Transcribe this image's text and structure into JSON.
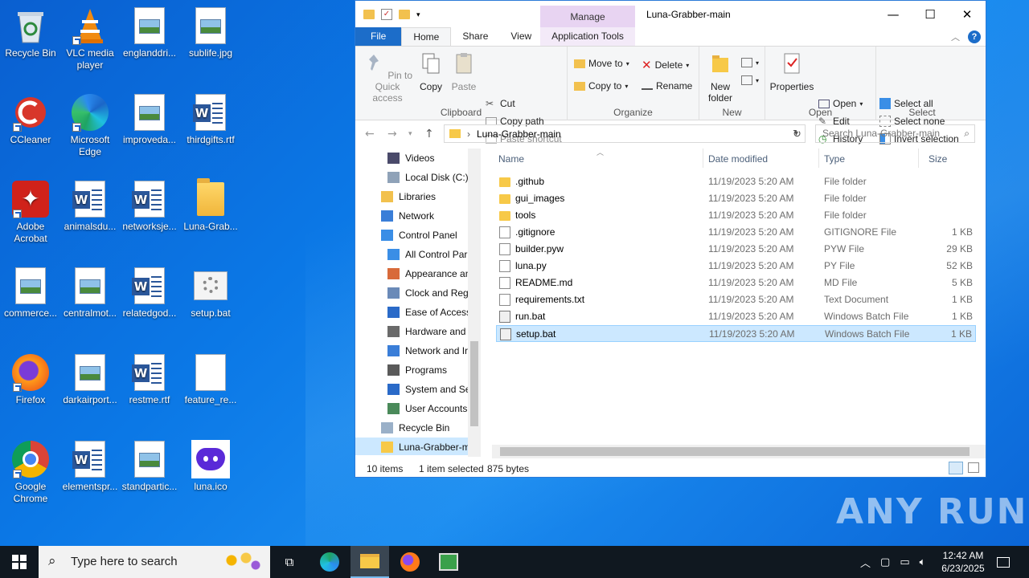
{
  "desktop": {
    "icons": [
      {
        "label": "Recycle Bin",
        "icon": "recycle-bin-icon"
      },
      {
        "label": "VLC media player",
        "icon": "vlc-icon"
      },
      {
        "label": "englanddri...",
        "icon": "image-file-icon"
      },
      {
        "label": "sublife.jpg",
        "icon": "image-file-icon"
      },
      {
        "label": "CCleaner",
        "icon": "ccleaner-icon"
      },
      {
        "label": "Microsoft Edge",
        "icon": "edge-icon"
      },
      {
        "label": "improveda...",
        "icon": "image-file-icon"
      },
      {
        "label": "thirdgifts.rtf",
        "icon": "word-doc-icon"
      },
      {
        "label": "Adobe Acrobat",
        "icon": "acrobat-icon"
      },
      {
        "label": "animalsdu...",
        "icon": "word-doc-icon"
      },
      {
        "label": "networksje...",
        "icon": "word-doc-icon"
      },
      {
        "label": "Luna-Grab...",
        "icon": "folder-icon"
      },
      {
        "label": "commerce...",
        "icon": "image-file-icon"
      },
      {
        "label": "centralmot...",
        "icon": "image-file-icon"
      },
      {
        "label": "relatedgod...",
        "icon": "word-doc-icon"
      },
      {
        "label": "setup.bat",
        "icon": "batch-file-icon"
      },
      {
        "label": "Firefox",
        "icon": "firefox-icon"
      },
      {
        "label": "darkairport...",
        "icon": "image-file-icon"
      },
      {
        "label": "restme.rtf",
        "icon": "word-doc-icon"
      },
      {
        "label": "feature_re...",
        "icon": "blank-file-icon"
      },
      {
        "label": "Google Chrome",
        "icon": "chrome-icon"
      },
      {
        "label": "elementspr...",
        "icon": "word-doc-icon"
      },
      {
        "label": "standpartic...",
        "icon": "image-file-icon"
      },
      {
        "label": "luna.ico",
        "icon": "discord-icon"
      }
    ]
  },
  "window": {
    "title": "Luna-Grabber-main",
    "manage_label": "Manage",
    "tabs": {
      "file": "File",
      "home": "Home",
      "share": "Share",
      "view": "View",
      "app_tools": "Application Tools"
    },
    "ribbon": {
      "clipboard": {
        "pin": "Pin to Quick access",
        "copy": "Copy",
        "paste": "Paste",
        "cut": "Cut",
        "copy_path": "Copy path",
        "paste_shortcut": "Paste shortcut",
        "title": "Clipboard"
      },
      "organize": {
        "move_to": "Move to",
        "copy_to": "Copy to",
        "delete": "Delete",
        "rename": "Rename",
        "title": "Organize"
      },
      "new": {
        "new_folder": "New folder",
        "title": "New"
      },
      "open": {
        "properties": "Properties",
        "open": "Open",
        "edit": "Edit",
        "history": "History",
        "title": "Open"
      },
      "select": {
        "select_all": "Select all",
        "select_none": "Select none",
        "invert": "Invert selection",
        "title": "Select"
      }
    },
    "address": {
      "path": "Luna-Grabber-main",
      "search_placeholder": "Search Luna-Grabber-main"
    },
    "nav": [
      {
        "label": "Videos",
        "indent": 2,
        "icon": "videos-icon"
      },
      {
        "label": "Local Disk (C:)",
        "indent": 2,
        "icon": "drive-icon"
      },
      {
        "label": "Libraries",
        "indent": 1,
        "icon": "libraries-icon"
      },
      {
        "label": "Network",
        "indent": 1,
        "icon": "network-icon"
      },
      {
        "label": "Control Panel",
        "indent": 1,
        "icon": "control-panel-icon"
      },
      {
        "label": "All Control Par",
        "indent": 2,
        "icon": "control-panel-icon"
      },
      {
        "label": "Appearance an",
        "indent": 2,
        "icon": "appearance-icon"
      },
      {
        "label": "Clock and Regi",
        "indent": 2,
        "icon": "clock-icon"
      },
      {
        "label": "Ease of Access",
        "indent": 2,
        "icon": "ease-access-icon"
      },
      {
        "label": "Hardware and",
        "indent": 2,
        "icon": "hardware-icon"
      },
      {
        "label": "Network and Ir",
        "indent": 2,
        "icon": "network-icon"
      },
      {
        "label": "Programs",
        "indent": 2,
        "icon": "programs-icon"
      },
      {
        "label": "System and Sec",
        "indent": 2,
        "icon": "shield-icon"
      },
      {
        "label": "User Accounts",
        "indent": 2,
        "icon": "users-icon"
      },
      {
        "label": "Recycle Bin",
        "indent": 1,
        "icon": "recycle-bin-icon"
      },
      {
        "label": "Luna-Grabber-m",
        "indent": 1,
        "icon": "folder-icon",
        "selected": true
      }
    ],
    "columns": {
      "name": "Name",
      "date": "Date modified",
      "type": "Type",
      "size": "Size"
    },
    "files": [
      {
        "name": ".github",
        "date": "11/19/2023 5:20 AM",
        "type": "File folder",
        "size": "",
        "kind": "folder"
      },
      {
        "name": "gui_images",
        "date": "11/19/2023 5:20 AM",
        "type": "File folder",
        "size": "",
        "kind": "folder"
      },
      {
        "name": "tools",
        "date": "11/19/2023 5:20 AM",
        "type": "File folder",
        "size": "",
        "kind": "folder"
      },
      {
        "name": ".gitignore",
        "date": "11/19/2023 5:20 AM",
        "type": "GITIGNORE File",
        "size": "1 KB",
        "kind": "file"
      },
      {
        "name": "builder.pyw",
        "date": "11/19/2023 5:20 AM",
        "type": "PYW File",
        "size": "29 KB",
        "kind": "file"
      },
      {
        "name": "luna.py",
        "date": "11/19/2023 5:20 AM",
        "type": "PY File",
        "size": "52 KB",
        "kind": "file"
      },
      {
        "name": "README.md",
        "date": "11/19/2023 5:20 AM",
        "type": "MD File",
        "size": "5 KB",
        "kind": "file"
      },
      {
        "name": "requirements.txt",
        "date": "11/19/2023 5:20 AM",
        "type": "Text Document",
        "size": "1 KB",
        "kind": "file"
      },
      {
        "name": "run.bat",
        "date": "11/19/2023 5:20 AM",
        "type": "Windows Batch File",
        "size": "1 KB",
        "kind": "bat"
      },
      {
        "name": "setup.bat",
        "date": "11/19/2023 5:20 AM",
        "type": "Windows Batch File",
        "size": "1 KB",
        "kind": "bat",
        "selected": true
      }
    ],
    "status": {
      "count": "10 items",
      "selected": "1 item selected",
      "size": "875 bytes"
    }
  },
  "taskbar": {
    "search_placeholder": "Type here to search",
    "time": "12:42 AM",
    "date": "6/23/2025"
  },
  "watermark": "ANY RUN"
}
